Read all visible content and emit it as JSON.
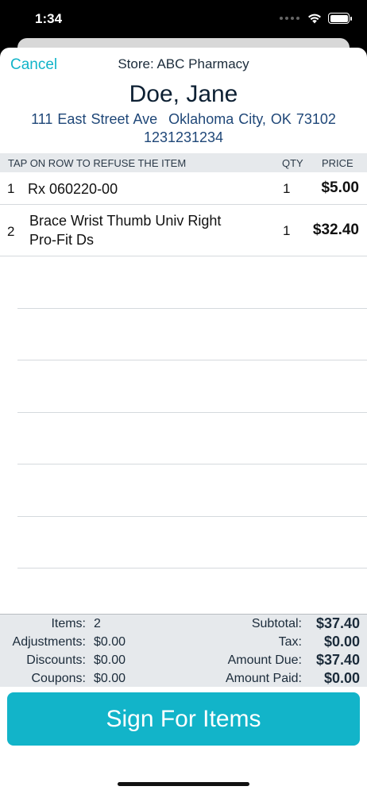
{
  "status": {
    "time": "1:34"
  },
  "header": {
    "cancel_label": "Cancel",
    "store": "Store: ABC Pharmacy",
    "customer_name": "Doe, Jane",
    "address_street": "111 East Street Ave",
    "address_city": "Oklahoma City, OK 73102",
    "phone": "1231231234"
  },
  "table": {
    "instruction": "TAP ON ROW TO REFUSE THE ITEM",
    "qty_header": "QTY",
    "price_header": "PRICE",
    "rows": [
      {
        "num": "1",
        "line1": "Rx 060220-00",
        "line2": "",
        "qty": "1",
        "price": "$5.00"
      },
      {
        "num": "2",
        "line1": "Brace Wrist Thumb Univ Right",
        "line2": "Pro-Fit Ds",
        "qty": "1",
        "price": "$32.40"
      }
    ]
  },
  "totals": {
    "items_label": "Items:",
    "items_value": "2",
    "adjustments_label": "Adjustments:",
    "adjustments_value": "$0.00",
    "discounts_label": "Discounts:",
    "discounts_value": "$0.00",
    "coupons_label": "Coupons:",
    "coupons_value": "$0.00",
    "subtotal_label": "Subtotal:",
    "subtotal_value": "$37.40",
    "tax_label": "Tax:",
    "tax_value": "$0.00",
    "amount_due_label": "Amount Due:",
    "amount_due_value": "$37.40",
    "amount_paid_label": "Amount Paid:",
    "amount_paid_value": "$0.00"
  },
  "sign_button_label": "Sign For Items",
  "colors": {
    "accent": "#12b4c9",
    "address": "#1f4778",
    "header_bg": "#e6e9ec"
  }
}
